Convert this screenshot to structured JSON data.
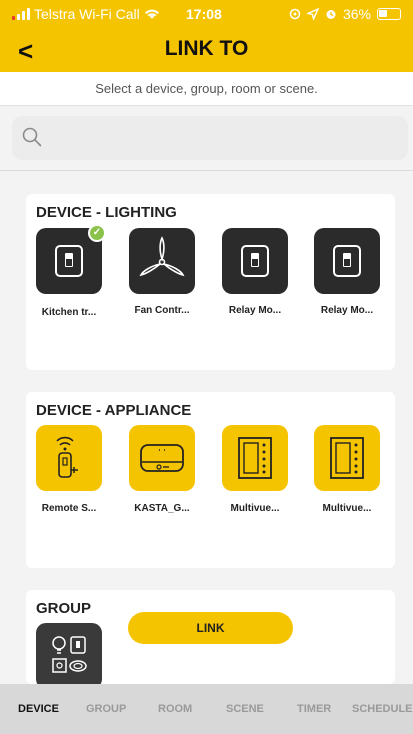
{
  "status_bar": {
    "carrier": "Telstra Wi-Fi Call",
    "time": "17:08",
    "battery": "36%"
  },
  "header": {
    "back_label": "<",
    "title": "LINK TO"
  },
  "subtitle": "Select a device, group, room or scene.",
  "search": {
    "placeholder": ""
  },
  "sections": {
    "lighting": {
      "title": "DEVICE - LIGHTING",
      "items": [
        {
          "label": "Kitchen tr...",
          "icon": "switch-icon",
          "selected": true
        },
        {
          "label": "Fan Contr...",
          "icon": "fan-icon",
          "selected": false
        },
        {
          "label": "Relay Mo...",
          "icon": "switch-icon",
          "selected": false
        },
        {
          "label": "Relay Mo...",
          "icon": "switch-icon",
          "selected": false
        }
      ]
    },
    "appliance": {
      "title": "DEVICE - APPLIANCE",
      "items": [
        {
          "label": "Remote S...",
          "icon": "remote-switch-icon"
        },
        {
          "label": "KASTA_G...",
          "icon": "gateway-icon"
        },
        {
          "label": "Multivue...",
          "icon": "multivue-panel-icon"
        },
        {
          "label": "Multivue...",
          "icon": "multivue-panel-icon"
        }
      ]
    },
    "group": {
      "title": "GROUP",
      "items": [
        {
          "label": "",
          "icon": "group-devices-icon"
        }
      ]
    }
  },
  "link_button": "LINK",
  "tabs": [
    "DEVICE",
    "GROUP",
    "ROOM",
    "SCENE",
    "TIMER",
    "SCHEDULE"
  ],
  "active_tab": "DEVICE",
  "colors": {
    "accent": "#f5c400",
    "tile_dark": "#2b2b2b",
    "check": "#8bc34a"
  }
}
